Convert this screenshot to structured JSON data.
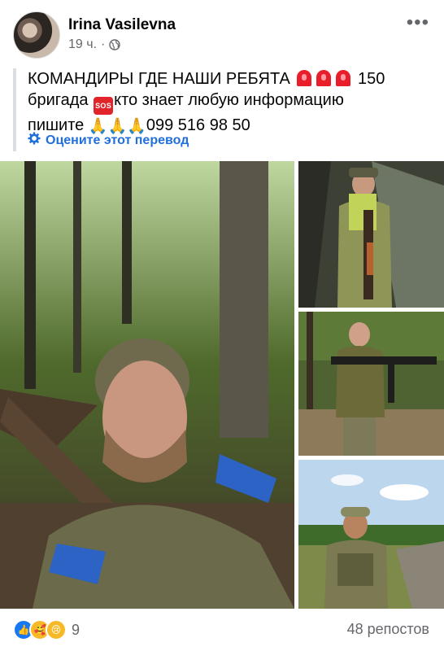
{
  "post": {
    "author": "Irina Vasilevna",
    "time": "19 ч.",
    "separator": "·",
    "text": {
      "line1": "КОМАНДИРЫ ГДЕ НАШИ РЕБЯТА",
      "line1_end": "150",
      "line2_start": "бригада",
      "line2_end": "кто знает любую информацию",
      "line3_start": "пишите",
      "line3_end": "099 516 98 50"
    },
    "sos_emoji_text": "SOS",
    "translate_label": "Оцените этот перевод"
  },
  "photos": [
    {
      "name": "main-photo"
    },
    {
      "name": "side-photo-1"
    },
    {
      "name": "side-photo-2"
    },
    {
      "name": "side-photo-3"
    }
  ],
  "footer": {
    "reaction_count": "9",
    "shares": "48 репостов"
  },
  "icons": {
    "globe": "globe-icon",
    "more": "more-options-icon",
    "gear": "gear-icon",
    "siren": "police-light-emoji",
    "sos": "sos-emoji",
    "pray": "folded-hands-emoji",
    "like": "like-reaction-icon",
    "love": "care-reaction-icon",
    "sad": "sad-reaction-icon"
  },
  "colors": {
    "link_blue": "#216fdb",
    "meta_gray": "#65676b",
    "like_blue": "#1877f2"
  }
}
